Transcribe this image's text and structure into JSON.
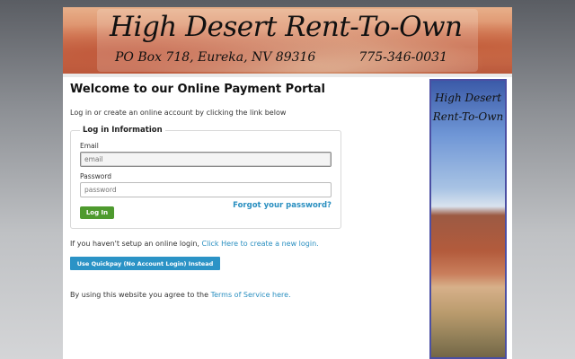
{
  "banner": {
    "title": "High Desert Rent-To-Own",
    "address": "PO Box 718, Eureka, NV 89316",
    "phone": "775-346-0031"
  },
  "page": {
    "heading": "Welcome to our Online Payment Portal",
    "intro": "Log in or create an online account by clicking the link below"
  },
  "login": {
    "legend": "Log in Information",
    "email_label": "Email",
    "email_placeholder": "email",
    "password_label": "Password",
    "password_placeholder": "password",
    "login_button": "Log In",
    "forgot_link": "Forgot your password?"
  },
  "signup": {
    "text": "If you haven't setup an online login,",
    "link": "Click Here to create a new login."
  },
  "quickpay": {
    "button": "Use Quickpay (No Account Login) Instead"
  },
  "terms": {
    "text": "By using this website you agree to the",
    "link": "Terms of Service here."
  },
  "sidebar": {
    "line1": "High Desert",
    "line2": "Rent-To-Own"
  }
}
